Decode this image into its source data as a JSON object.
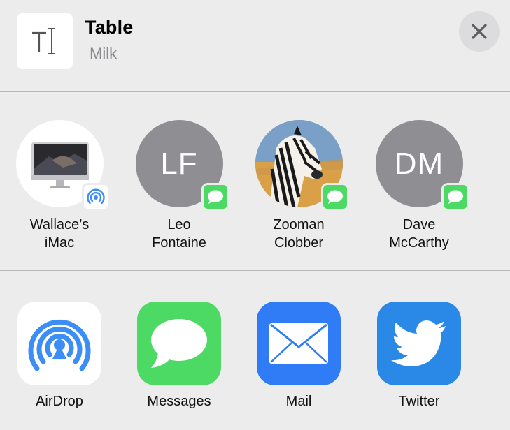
{
  "header": {
    "title": "Table",
    "subtitle": "Milk",
    "thumb_icon": "text-cursor-icon",
    "close_icon": "close-icon"
  },
  "people": [
    {
      "name_line1": "Wallace’s",
      "name_line2": "iMac",
      "avatar": "imac-image",
      "badge": "airdrop"
    },
    {
      "name_line1": "Leo",
      "name_line2": "Fontaine",
      "initials": "LF",
      "badge": "messages"
    },
    {
      "name_line1": "Zooman",
      "name_line2": "Clobber",
      "avatar": "zebra-photo",
      "badge": "messages"
    },
    {
      "name_line1": "Dave",
      "name_line2": "McCarthy",
      "initials": "DM",
      "badge": "messages"
    }
  ],
  "apps": [
    {
      "label": "AirDrop",
      "icon": "airdrop-icon"
    },
    {
      "label": "Messages",
      "icon": "messages-icon"
    },
    {
      "label": "Mail",
      "icon": "mail-icon"
    },
    {
      "label": "Twitter",
      "icon": "twitter-icon"
    }
  ],
  "colors": {
    "background": "#ececec",
    "messages_green": "#4cd964",
    "airdrop_blue": "#3a8ef5",
    "mail_blue": "#2f7cf6",
    "twitter_blue": "#2a88e6",
    "avatar_gray": "#8e8e93"
  }
}
